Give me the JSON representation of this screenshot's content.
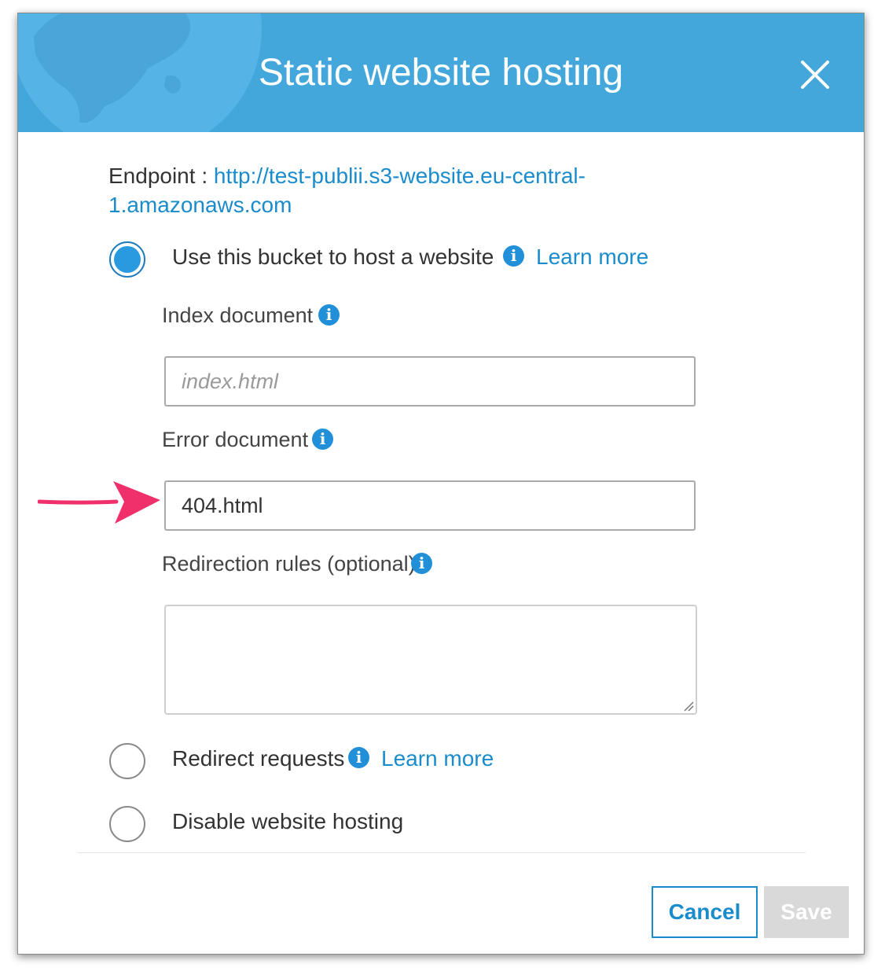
{
  "dialog": {
    "title": "Static website hosting",
    "close_icon": "close-icon",
    "header_color": "#44a7dc"
  },
  "endpoint": {
    "label": "Endpoint : ",
    "url": "http://test-publii.s3-website.eu-central-1.amazonaws.com"
  },
  "options": {
    "host": {
      "label": "Use this bucket to host a website",
      "learn_more": "Learn more",
      "selected": true
    },
    "redirect": {
      "label": "Redirect requests",
      "learn_more": "Learn more",
      "selected": false
    },
    "disable": {
      "label": "Disable website hosting",
      "selected": false
    }
  },
  "fields": {
    "index_document": {
      "label": "Index document",
      "value": "",
      "placeholder": "index.html"
    },
    "error_document": {
      "label": "Error document",
      "value": "404.html"
    },
    "redirection_rules": {
      "label": "Redirection rules (optional)",
      "value": ""
    }
  },
  "info_icon": {
    "glyph": "i",
    "color": "#2290d8"
  },
  "annotation": {
    "arrow_color": "#f0306a",
    "icon": "arrow-right-icon"
  },
  "buttons": {
    "cancel": "Cancel",
    "save": "Save",
    "save_enabled": false
  },
  "colors": {
    "accent": "#1a8ccc",
    "radio_selected": "#2a9ae0"
  }
}
